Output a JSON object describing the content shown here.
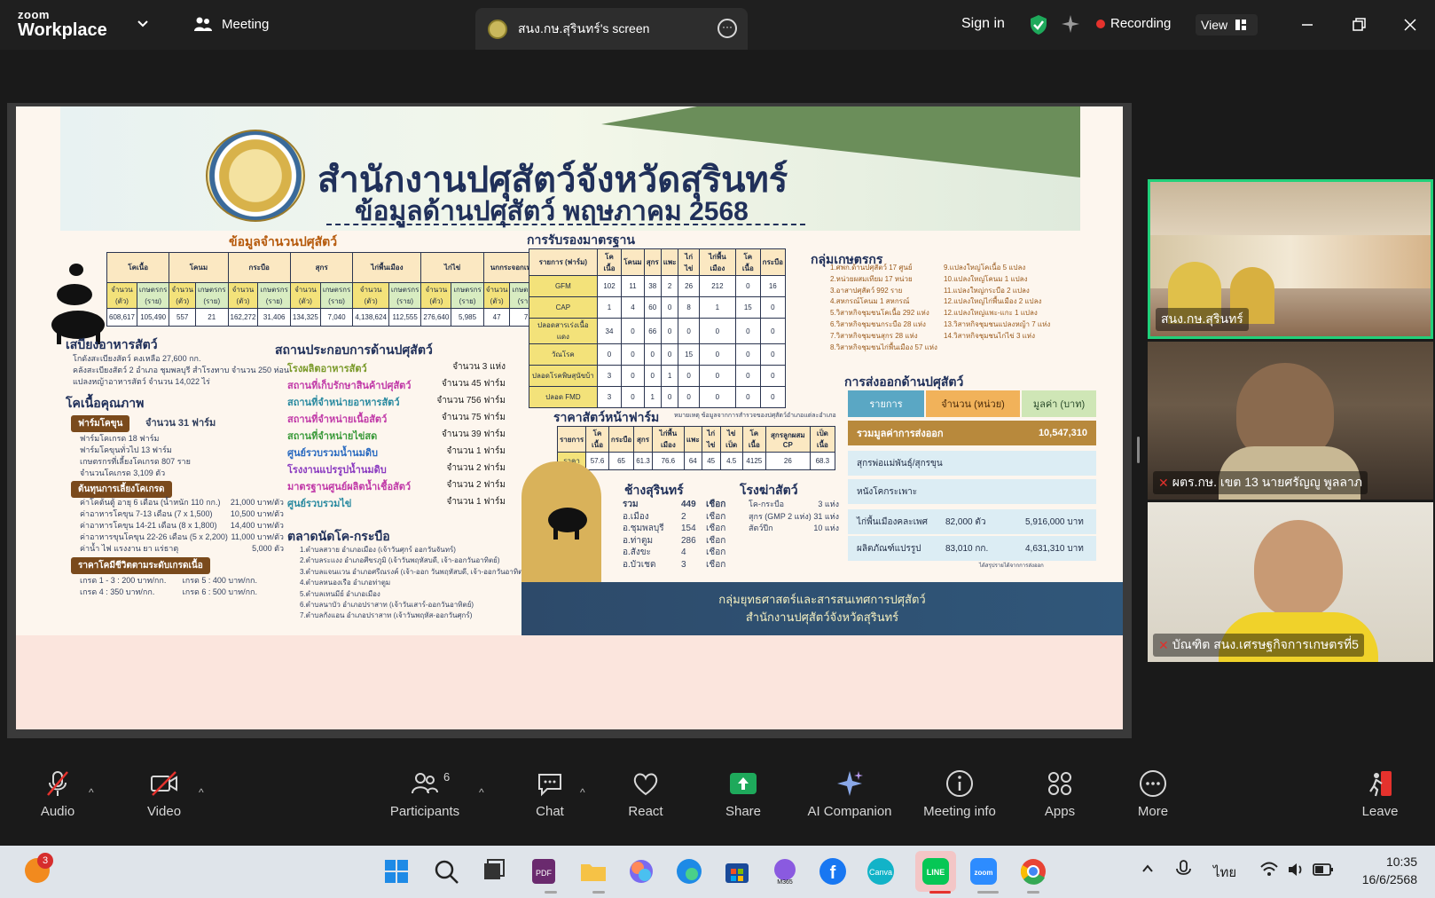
{
  "app": {
    "brand_small": "zoom",
    "brand_large": "Workplace",
    "meeting_label": "Meeting",
    "screen_tab_title": "สนง.กษ.สุรินทร์'s screen",
    "sign_in": "Sign in",
    "recording": "Recording",
    "view": "View"
  },
  "slide": {
    "title_line1": "สำนักงานปศุสัตว์จังหวัดสุรินทร์",
    "title_line2": "ข้อมูลด้านปศุสัตว์ พฤษภาคม 2568",
    "headings": {
      "livestock_count": "ข้อมูลจำนวนปศุสัตว์",
      "feed": "เสบียงอาหารสัตว์",
      "quality_beef": "โคเนื้อคุณภาพ",
      "operators": "สถานประกอบการด้านปศุสัตว์",
      "standards": "การรับรองมาตรฐาน",
      "farm_price": "ราคาสัตว์หน้าฟาร์ม",
      "farmer_groups": "กลุ่มเกษตรกร",
      "export": "การส่งออกด้านปศุสัตว์",
      "elephants": "ช้างสุรินทร์",
      "slaughter": "โรงฆ่าสัตว์",
      "market": "ตลาดนัดโค-กระบือ"
    },
    "livestock_table": {
      "headers": [
        "โคเนื้อ",
        "โคนม",
        "กระบือ",
        "สุกร",
        "ไก่พื้นเมือง",
        "ไก่ไข่",
        "นกกระจอกเทศ"
      ],
      "sub": [
        "จำนวน (ตัว)",
        "เกษตรกร (ราย)"
      ],
      "values": [
        "608,617",
        "105,490",
        "557",
        "21",
        "162,272",
        "31,406",
        "134,325",
        "7,040",
        "4,138,624",
        "112,555",
        "276,640",
        "5,985",
        "47",
        "7"
      ]
    },
    "feed_lines": [
      "โกดังสะเบียงสัตว์ คงเหลือ 27,600 กก.",
      "คลังสะเบียงสัตว์ 2 อำเภอ ชุมพลบุรี สำโรงทาบ จำนวน 250 ห่อน",
      "แปลงหญ้าอาหารสัตว์ จำนวน 14,022 ไร่"
    ],
    "quality_farm_tag": "ฟาร์มโคขุน",
    "quality_farm_count": "จำนวน 31 ฟาร์ม",
    "quality_lines": [
      "ฟาร์มโคเกรด 18 ฟาร์ม",
      "ฟาร์มโคขุนทั่วไป 13 ฟาร์ม",
      "เกษตรกรที่เลี้ยงโคเกรด 807 ราย",
      "จำนวนโคเกรด 3,109 ตัว"
    ],
    "cost_tag": "ต้นทุนการเลี้ยงโคเกรด",
    "cost_lines": [
      [
        "ค่าโคต้นตู้ อายุ 6 เดือน (น้ำหนัก 110 กก.)",
        "21,000 บาท/ตัว"
      ],
      [
        "ค่าอาหารโคขุน 7-13 เดือน (7 x 1,500)",
        "10,500 บาท/ตัว"
      ],
      [
        "ค่าอาหารโคขุน 14-21 เดือน (8 x 1,800)",
        "14,400 บาท/ตัว"
      ],
      [
        "ค่าอาหารขุนโคขุน 22-26 เดือน (5 x 2,200)",
        "11,000 บาท/ตัว"
      ],
      [
        "ค่าน้ำ ไฟ แรงงาน ยา แร่ธาตุ",
        "5,000 ตัว"
      ]
    ],
    "grade_tag": "ราคาโคมีชีวิตตามระดับเกรดเนื้อ",
    "grade_lines": [
      [
        "เกรด 1 - 3 : 200 บาท/กก.",
        "เกรด 5 : 400 บาท/กก."
      ],
      [
        "เกรด 4 : 350 บาท/กก.",
        "เกรด 6 : 500 บาท/กก."
      ]
    ],
    "operators": [
      [
        "โรงผลิตอาหารสัตว์",
        "จำนวน 3 แห่ง"
      ],
      [
        "สถานที่เก็บรักษาสินค้าปศุสัตว์",
        "จำนวน 45 ฟาร์ม"
      ],
      [
        "สถานที่จำหน่ายอาหารสัตว์",
        "จำนวน 756 ฟาร์ม"
      ],
      [
        "สถานที่จำหน่ายเนื้อสัตว์",
        "จำนวน 75 ฟาร์ม"
      ],
      [
        "สถานที่จำหน่ายไข่สด",
        "จำนวน 39 ฟาร์ม"
      ],
      [
        "ศูนย์รวบรวมน้ำนมดิบ",
        "จำนวน 1 ฟาร์ม"
      ],
      [
        "โรงงานแปรรูปน้ำนมดิบ",
        "จำนวน 2 ฟาร์ม"
      ],
      [
        "มาตรฐานศูนย์ผลิตน้ำเชื้อสัตว์",
        "จำนวน 2 ฟาร์ม"
      ],
      [
        "ศูนย์รวบรวมไข่",
        "จำนวน 1 ฟาร์ม"
      ]
    ],
    "standards_table": {
      "headers": [
        "รายการ (ฟาร์ม)",
        "โคเนื้อ",
        "โคนม",
        "สุกร",
        "แพะ",
        "ไก่ไข่",
        "ไก่พื้นเมือง",
        "โคเนื้อ",
        "กระบือ"
      ],
      "rows": [
        [
          "GFM",
          "102",
          "11",
          "38",
          "2",
          "26",
          "212",
          "0",
          "16"
        ],
        [
          "CAP",
          "1",
          "4",
          "60",
          "0",
          "8",
          "1",
          "15",
          "0"
        ],
        [
          "ปลอดสารเร่งเนื้อแดง",
          "34",
          "0",
          "66",
          "0",
          "0",
          "0",
          "0",
          "0"
        ],
        [
          "วัณโรค",
          "0",
          "0",
          "0",
          "0",
          "15",
          "0",
          "0",
          "0"
        ],
        [
          "ปลอดโรคพิษสุนัขบ้า",
          "3",
          "0",
          "0",
          "1",
          "0",
          "0",
          "0",
          "0"
        ],
        [
          "ปลอด FMD",
          "3",
          "0",
          "1",
          "0",
          "0",
          "0",
          "0",
          "0"
        ]
      ]
    },
    "farm_price_note": "หมายเหตุ ข้อมูลจากการสำรวจของปศุสัตว์อำเภอแต่ละอำเภอ",
    "farm_price_table": {
      "headers": [
        "รายการ",
        "โคเนื้อ",
        "กระบือ",
        "สุกร",
        "ไก่พื้นเมือง",
        "แพะ",
        "ไก่ไข่",
        "ไข่เป็ด",
        "โคเนื้อ",
        "สุกรลูกผสม CP",
        "เป็ดเนื้อ"
      ],
      "row_label": "ราคา",
      "values": [
        "57.6",
        "65",
        "61.3",
        "76.6",
        "64",
        "45",
        "4.5",
        "4125",
        "26",
        "68.3"
      ]
    },
    "farmer_groups_left": [
      "1.ศพก.ด้านปศุสัตว์ 17 ศูนย์",
      "2.หน่วยผสมเทียม 17 หน่วย",
      "3.อาสาปศุสัตว์ 992 ราย",
      "4.สหกรณ์โคนม 1 สหกรณ์",
      "5.วิสาหกิจชุมชนโคเนื้อ 292 แห่ง",
      "6.วิสาหกิจชุมชนกระบือ 28 แห่ง",
      "7.วิสาหกิจชุมชนสุกร 28 แห่ง",
      "8.วิสาหกิจชุมชนไก่พื้นเมือง 57 แห่ง"
    ],
    "farmer_groups_right": [
      "9.แปลงใหญ่โคเนื้อ 5 แปลง",
      "10.แปลงใหญ่โคนม 1 แปลง",
      "11.แปลงใหญ่กระบือ 2 แปลง",
      "12.แปลงใหญ่ไก่พื้นเมือง 2 แปลง",
      "12.แปลงใหญ่แพะ-แกะ 1 แปลง",
      "13.วิสาหกิจชุมชนแปลงหญ้า 7 แห่ง",
      "14.วิสาหกิจชุมชนไก่ไข่ 3 แห่ง"
    ],
    "export_headers": [
      "รายการ",
      "จำนวน (หน่วย)",
      "มูลค่า (บาท)"
    ],
    "export_total_label": "รวมมูลค่าการส่งออก",
    "export_total_value": "10,547,310",
    "export_rows": [
      [
        "สุกรพ่อแม่พันธุ์/สุกรขุน",
        "",
        ""
      ],
      [
        "หนังโคกระเพาะ",
        "",
        ""
      ],
      [
        "ไก่พื้นเมืองคละเพศ",
        "82,000 ตัว",
        "5,916,000 บาท"
      ],
      [
        "ผลิตภัณฑ์แปรรูป",
        "83,010 กก.",
        "4,631,310 บาท"
      ]
    ],
    "export_note": "ได้สรุปรายได้จากการส่งออก",
    "elephants": [
      [
        "รวม",
        "449",
        "เชือก"
      ],
      [
        "อ.เมือง",
        "2",
        "เชือก"
      ],
      [
        "อ.ชุมพลบุรี",
        "154",
        "เชือก"
      ],
      [
        "อ.ท่าตูม",
        "286",
        "เชือก"
      ],
      [
        "อ.สังขะ",
        "4",
        "เชือก"
      ],
      [
        "อ.บัวเชด",
        "3",
        "เชือก"
      ]
    ],
    "slaughter": [
      [
        "โค-กระบือ",
        "3 แห่ง"
      ],
      [
        "สุกร (GMP 2 แห่ง)",
        "31 แห่ง"
      ],
      [
        "สัตว์ปีก",
        "10 แห่ง"
      ]
    ],
    "market_lines": [
      "1.ตำบลสวาย อำเภอเมือง (เจ้าวันศุกร์ ออกวันจันทร์)",
      "2.ตำบลระแงง อำเภอศีขรภูมิ (เจ้าวันพฤหัสบดี, เจ้า-ออกวันอาทิตย์)",
      "3.ตำบลแจนแวน อำเภอศรีณรงค์ (เจ้า-ออก วันพฤหัสบดี, เจ้า-ออกวันอาทิตย์)",
      "4.ตำบลหนองเรือ อำเภอท่าตูม",
      "5.ตำบลเทนมีย์ อำเภอเมือง",
      "6.ตำบลนาบัว อำเภอปราสาท (เจ้าวันเสาร์-ออกวันอาทิตย์)",
      "7.ตำบลกังแอน อำเภอปราสาท (เจ้าวันพฤหัส-ออกวันศุกร์)"
    ],
    "footer_line1": "กลุ่มยุทธศาสตร์และสารสนเทศการปศุสัตว์",
    "footer_line2": "สำนักงานปศุสัตว์จังหวัดสุรินทร์"
  },
  "participants": [
    {
      "name": "สนง.กษ.สุรินทร์",
      "muted": false
    },
    {
      "name": "ผตร.กษ. เขต 13 นายศรัญญู พูลลาภ",
      "muted": true
    },
    {
      "name": "บัณฑิต สนง.เศรษฐกิจการเกษตรที่5",
      "muted": true
    }
  ],
  "toolbar": {
    "audio": "Audio",
    "video": "Video",
    "participants": "Participants",
    "participants_count": "6",
    "chat": "Chat",
    "react": "React",
    "share": "Share",
    "ai_companion": "AI Companion",
    "meeting_info": "Meeting info",
    "apps": "Apps",
    "more": "More",
    "leave": "Leave"
  },
  "taskbar": {
    "badge_count": "3",
    "lang": "ไทย",
    "time": "10:35",
    "date": "16/6/2568"
  },
  "colors": {
    "zoom_bg": "#1a1a1a",
    "recording_red": "#e5322d",
    "share_green": "#1ea95b",
    "tile_border": "#21d07a"
  }
}
